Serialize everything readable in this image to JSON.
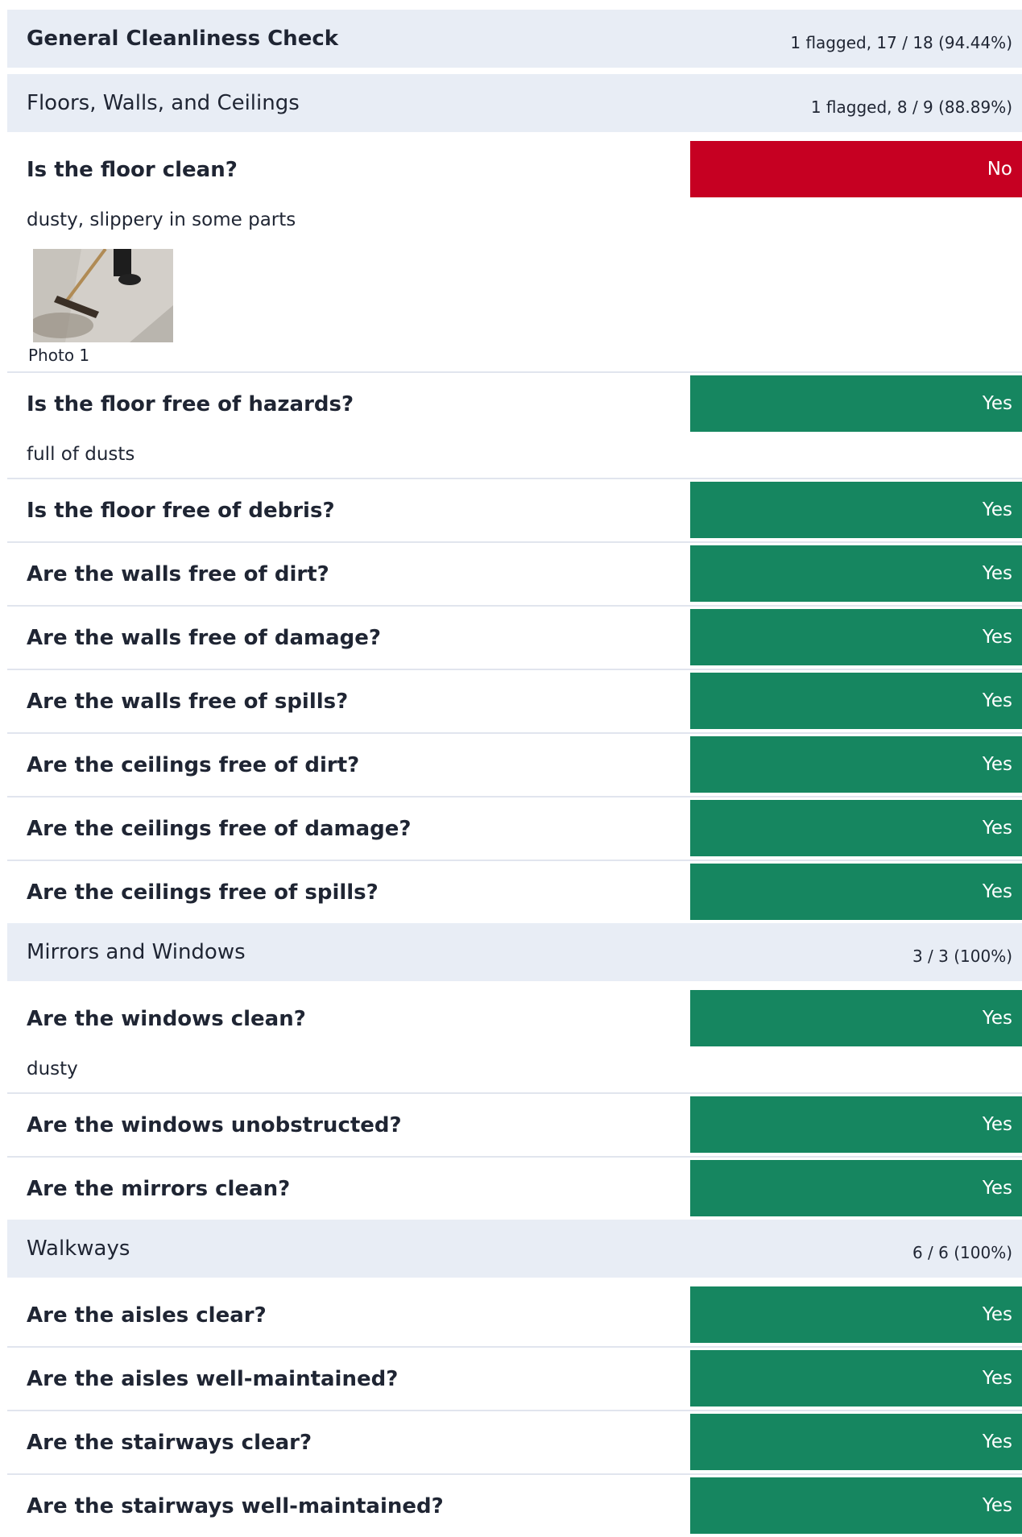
{
  "sections": [
    {
      "title": "General Cleanliness Check",
      "score": "1 flagged, 17 / 18 (94.44%)"
    },
    {
      "title": "Floors, Walls, and Ceilings",
      "score": "1 flagged, 8 / 9 (88.89%)"
    },
    {
      "title": "Mirrors and Windows",
      "score": "3 / 3 (100%)"
    },
    {
      "title": "Walkways",
      "score": "6 / 6 (100%)"
    }
  ],
  "items": [
    {
      "q": "Is the floor clean?",
      "a": "No",
      "note": "dusty, slippery in some parts",
      "photo": "Photo 1"
    },
    {
      "q": "Is the floor free of hazards?",
      "a": "Yes",
      "note": "full of dusts"
    },
    {
      "q": "Is the floor free of debris?",
      "a": "Yes"
    },
    {
      "q": "Are the walls free of dirt?",
      "a": "Yes"
    },
    {
      "q": "Are the walls free of damage?",
      "a": "Yes"
    },
    {
      "q": "Are the walls free of spills?",
      "a": "Yes"
    },
    {
      "q": "Are the ceilings free of dirt?",
      "a": "Yes"
    },
    {
      "q": "Are the ceilings free of damage?",
      "a": "Yes"
    },
    {
      "q": "Are the ceilings free of spills?",
      "a": "Yes"
    },
    {
      "q": "Are the windows clean?",
      "a": "Yes",
      "note": "dusty"
    },
    {
      "q": "Are the windows unobstructed?",
      "a": "Yes"
    },
    {
      "q": "Are the mirrors clean?",
      "a": "Yes"
    },
    {
      "q": "Are the aisles clear?",
      "a": "Yes"
    },
    {
      "q": "Are the aisles well-maintained?",
      "a": "Yes"
    },
    {
      "q": "Are the stairways clear?",
      "a": "Yes"
    },
    {
      "q": "Are the stairways well-maintained?",
      "a": "Yes"
    }
  ],
  "colors": {
    "yes": "#168660",
    "no": "#c60022",
    "section_bg": "#e8edf5"
  }
}
